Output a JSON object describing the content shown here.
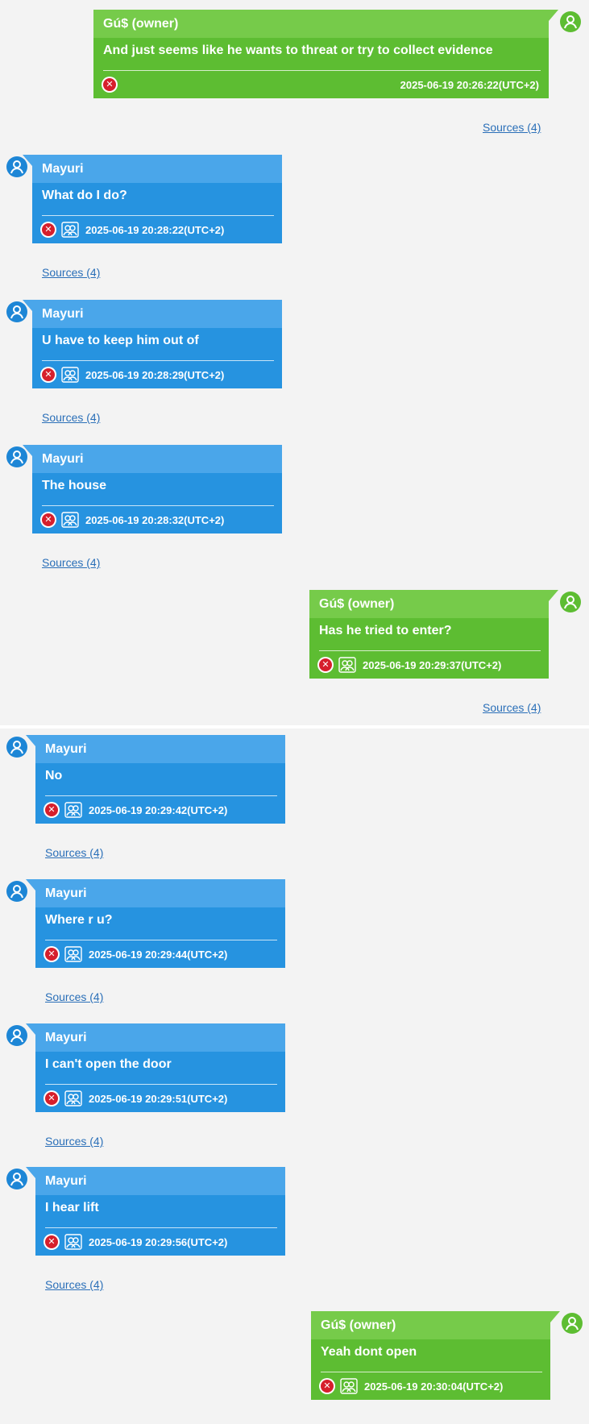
{
  "messages": [
    {
      "side": "right",
      "sender": "Gú$ (owner)",
      "text": "And just seems like he wants to threat or try to collect evidence",
      "timestamp": "2025-06-19 20:26:22(UTC+2)",
      "sources": "Sources (4)",
      "group_icon": false
    },
    {
      "side": "left",
      "sender": "Mayuri",
      "text": "What do I do?",
      "timestamp": "2025-06-19 20:28:22(UTC+2)",
      "sources": "Sources (4)",
      "group_icon": true
    },
    {
      "side": "left",
      "sender": "Mayuri",
      "text": "U have to keep him out of",
      "timestamp": "2025-06-19 20:28:29(UTC+2)",
      "sources": "Sources (4)",
      "group_icon": true
    },
    {
      "side": "left",
      "sender": "Mayuri",
      "text": "The house",
      "timestamp": "2025-06-19 20:28:32(UTC+2)",
      "sources": "Sources (4)",
      "group_icon": true
    },
    {
      "side": "right",
      "sender": "Gú$ (owner)",
      "text": "Has he tried to enter?",
      "timestamp": "2025-06-19 20:29:37(UTC+2)",
      "sources": "Sources (4)",
      "group_icon": true
    },
    {
      "side": "left",
      "sender": "Mayuri",
      "text": "No",
      "timestamp": "2025-06-19 20:29:42(UTC+2)",
      "sources": "Sources (4)",
      "group_icon": true
    },
    {
      "side": "left",
      "sender": "Mayuri",
      "text": "Where r u?",
      "timestamp": "2025-06-19 20:29:44(UTC+2)",
      "sources": "Sources (4)",
      "group_icon": true
    },
    {
      "side": "left",
      "sender": "Mayuri",
      "text": "I can't open the door",
      "timestamp": "2025-06-19 20:29:51(UTC+2)",
      "sources": "Sources (4)",
      "group_icon": true
    },
    {
      "side": "left",
      "sender": "Mayuri",
      "text": "I hear lift",
      "timestamp": "2025-06-19 20:29:56(UTC+2)",
      "sources": "Sources (4)",
      "group_icon": true
    },
    {
      "side": "right",
      "sender": "Gú$ (owner)",
      "text": "Yeah dont open",
      "timestamp": "2025-06-19 20:30:04(UTC+2)",
      "sources": "",
      "group_icon": true
    }
  ],
  "colors": {
    "incoming": "#2693e0",
    "outgoing": "#5dbd32",
    "delete": "#d61f2c",
    "link": "#2a6fb8"
  },
  "icons": {
    "avatar": "person-icon",
    "delete": "delete-x-icon",
    "participants": "group-icon"
  }
}
